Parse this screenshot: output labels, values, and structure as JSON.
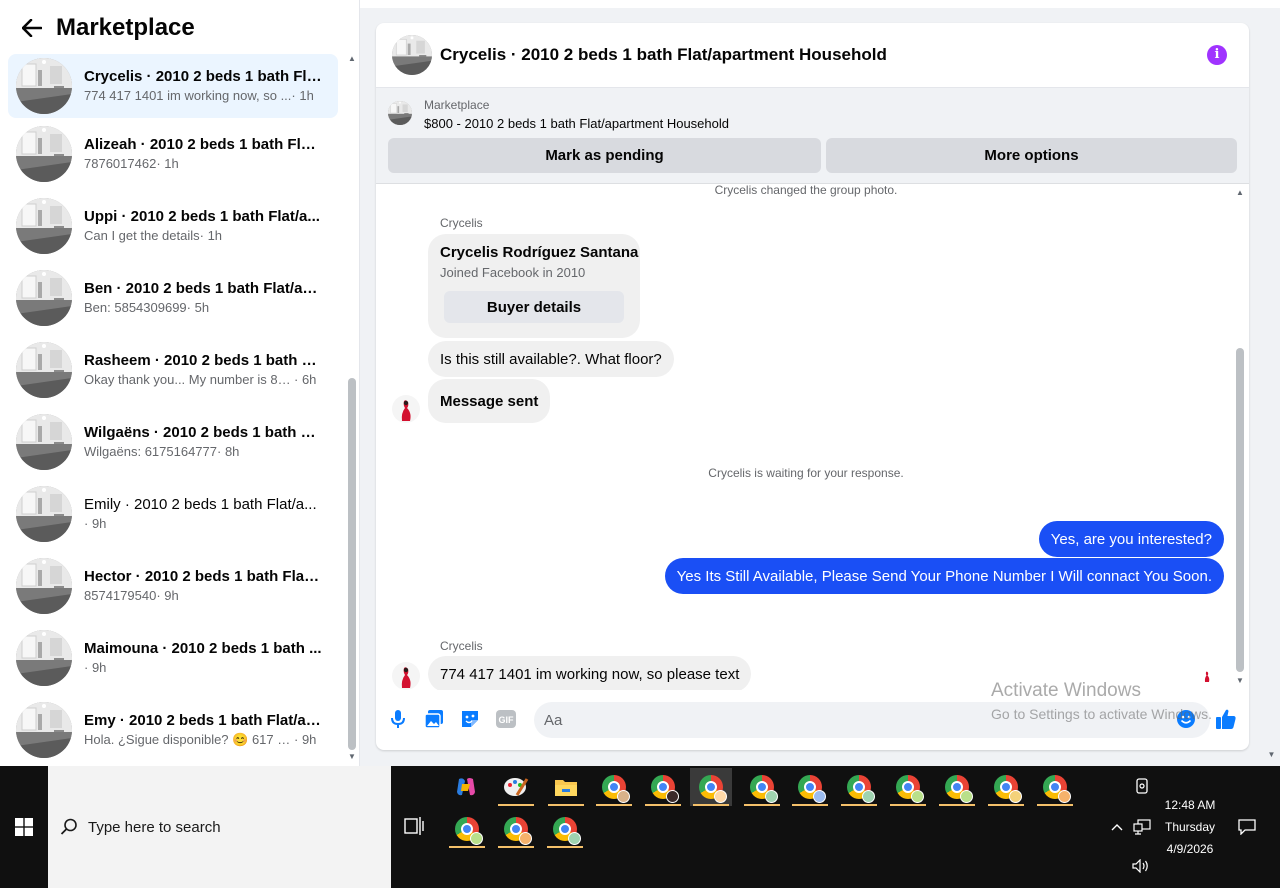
{
  "sidebar": {
    "title": "Marketplace",
    "conversations": [
      {
        "name": "Crycelis · 2010 2 beds 1 bath Flat...",
        "snippet": "774 417 1401 im working now, so ...",
        "time": " · 1h",
        "active": true,
        "read": false
      },
      {
        "name": "Alizeah · 2010 2 beds 1 bath Flat...",
        "snippet": "7876017462",
        "time": " · 1h",
        "active": false,
        "read": false
      },
      {
        "name": "Uppi · 2010 2 beds 1 bath Flat/a...",
        "snippet": "Can I get the details",
        "time": " · 1h",
        "active": false,
        "read": false
      },
      {
        "name": "Ben · 2010 2 beds 1 bath Flat/ap...",
        "snippet": "Ben: 5854309699",
        "time": " · 5h",
        "active": false,
        "read": false
      },
      {
        "name": "Rasheem · 2010 2 beds 1 bath Fl...",
        "snippet": "Okay thank you... My number is 85...",
        "time": " · 6h",
        "active": false,
        "read": false
      },
      {
        "name": "Wilgaëns · 2010 2 beds 1 bath Fl...",
        "snippet": "Wilgaëns: 6175164777",
        "time": " · 8h",
        "active": false,
        "read": false
      },
      {
        "name": "Emily · 2010 2 beds 1 bath Flat/a...",
        "snippet": "",
        "time": " · 9h",
        "active": false,
        "read": true
      },
      {
        "name": "Hector · 2010 2 beds 1 bath Flat/...",
        "snippet": "8574179540",
        "time": " · 9h",
        "active": false,
        "read": false
      },
      {
        "name": "Maimouna · 2010 2 beds 1 bath ...",
        "snippet": "",
        "time": " · 9h",
        "active": false,
        "read": false
      },
      {
        "name": "Emy · 2010 2 beds 1 bath Flat/ap...",
        "snippet": "Hola. ¿Sigue disponible? 😊 617 51...",
        "time": " · 9h",
        "active": false,
        "read": false
      }
    ]
  },
  "chat": {
    "title": "Crycelis · 2010 2 beds 1 bath Flat/apartment Household",
    "listing_label": "Marketplace",
    "listing_price": "$800 - 2010 2 beds 1 bath Flat/apartment Household",
    "mark_pending": "Mark as pending",
    "more_options": "More options",
    "sys_group_photo": "Crycelis changed the group photo.",
    "sender_1": "Crycelis",
    "card_name": "Crycelis Rodríguez Santana",
    "card_joined": "Joined Facebook in 2010",
    "card_button": "Buyer details",
    "msg_in_1": "Is this still available?. What floor?",
    "msg_in_2": "Message sent",
    "sys_waiting": "Crycelis is waiting for your response.",
    "msg_out_1": "Yes, are you interested?",
    "msg_out_2": "Yes Its Still Available, Please Send Your Phone Number I Will connact You Soon.",
    "sender_2": "Crycelis",
    "msg_in_3": "774 417 1401 im working now, so please text",
    "composer_placeholder": "Aa"
  },
  "watermark": {
    "line1": "Activate Windows",
    "line2": "Go to Settings to activate Windows."
  },
  "taskbar": {
    "search_placeholder": "Type here to search",
    "time": "12:48 AM",
    "day": "Thursday",
    "date": "4/9/2026"
  },
  "colors": {
    "accent": "#1a4ff5",
    "active_conv": "#ebf5ff",
    "info": "#a033ff",
    "taskbar": "#101010"
  }
}
